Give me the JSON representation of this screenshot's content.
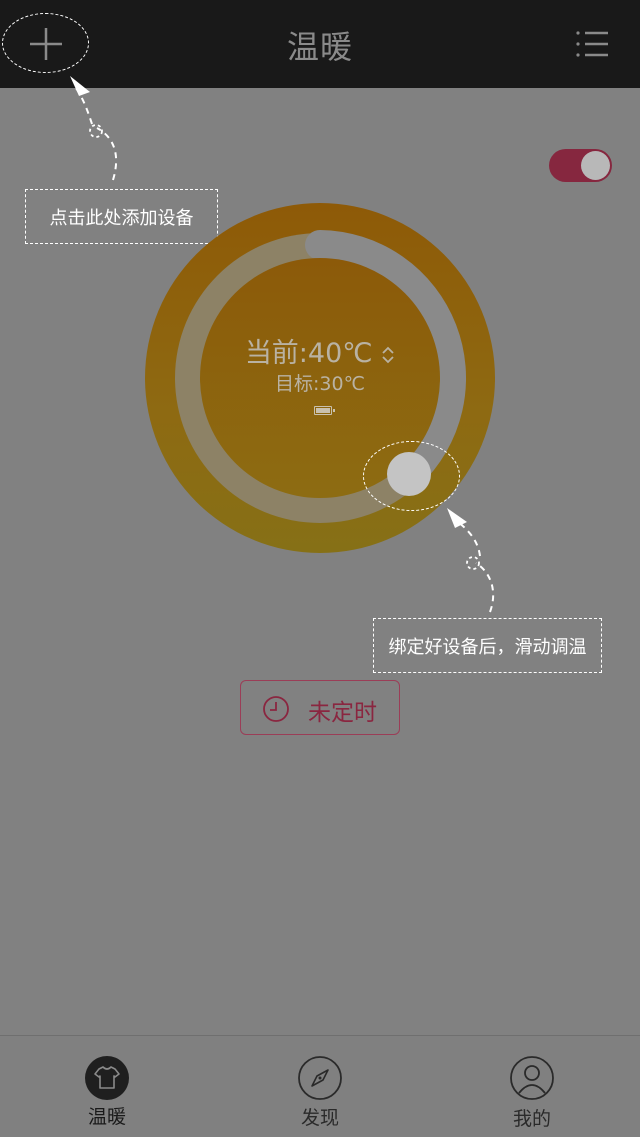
{
  "header": {
    "title": "温暖",
    "add_icon": "plus-icon",
    "menu_icon": "list-menu-icon"
  },
  "hints": {
    "add_device": "点击此处添加设备",
    "slide_adjust": "绑定好设备后，滑动调温"
  },
  "power_toggle": {
    "on": true,
    "color": "#86273f"
  },
  "dial": {
    "current_label": "当前:40℃",
    "target_label": "目标:30℃",
    "battery_icon": "battery-icon",
    "updown_icon": "updown-chevron-icon",
    "accent": "#8e5a07"
  },
  "timer": {
    "label": "未定时",
    "icon": "clock-icon",
    "color": "#8a2640"
  },
  "tabs": [
    {
      "label": "温暖",
      "icon": "shirt-icon",
      "active": true
    },
    {
      "label": "发现",
      "icon": "compass-icon",
      "active": false
    },
    {
      "label": "我的",
      "icon": "user-icon",
      "active": false
    }
  ]
}
